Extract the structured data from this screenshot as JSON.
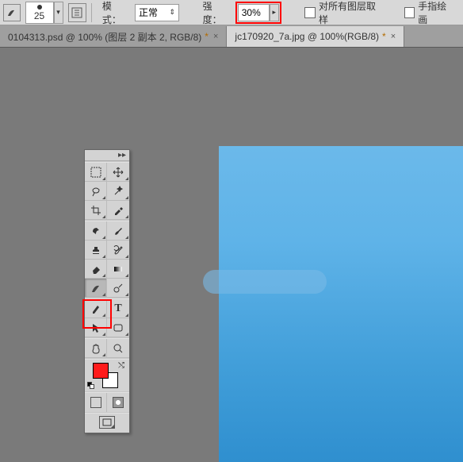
{
  "options": {
    "brush_size": "25",
    "mode_label": "模式：",
    "mode_value": "正常",
    "strength_label": "强度：",
    "strength_value": "30%",
    "sample_all_label": "对所有图层取样",
    "finger_paint_label": "手指绘画"
  },
  "tabs": [
    {
      "label": "0104313.psd @ 100% (图层 2 副本 2, RGB/8)",
      "dirty": "*",
      "active": false
    },
    {
      "label": "jc170920_7a.jpg @ 100%(RGB/8)",
      "dirty": "*",
      "active": true
    }
  ],
  "tools": {
    "rows": [
      [
        "marquee",
        "move"
      ],
      [
        "lasso",
        "magic-wand"
      ],
      [
        "crop",
        "eyedropper"
      ],
      [
        "sep"
      ],
      [
        "healing",
        "brush"
      ],
      [
        "stamp",
        "history-brush"
      ],
      [
        "eraser",
        "gradient"
      ],
      [
        "smudge",
        "dodge"
      ],
      [
        "sep"
      ],
      [
        "pen",
        "type"
      ],
      [
        "path-select",
        "shape"
      ],
      [
        "sep"
      ],
      [
        "hand",
        "zoom"
      ],
      [
        "sep"
      ]
    ],
    "selected": "smudge",
    "colors": {
      "fg": "#ff1b1b",
      "bg": "#ffffff"
    }
  }
}
